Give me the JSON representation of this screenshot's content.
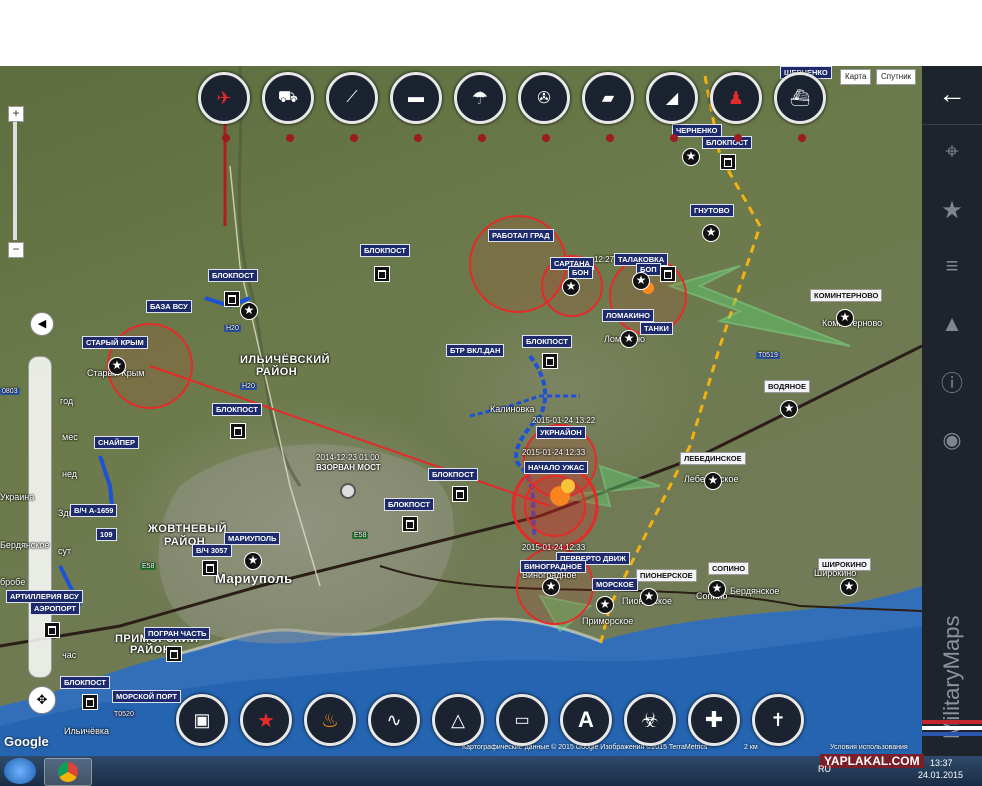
{
  "map_controls": {
    "map_type_map": "Карта",
    "map_type_satellite": "Спутник",
    "zoom_in": "+",
    "zoom_out": "−",
    "google_logo": "Google",
    "attribution": "Картографические данные © 2015 Google Изображения ©2015 TerraMetrics",
    "scale": "2 км",
    "terms": "Условия использования"
  },
  "top_toolbar": {
    "buttons": [
      {
        "name": "aircraft",
        "icon": "jet-icon"
      },
      {
        "name": "armored-car",
        "icon": "armored-car-icon"
      },
      {
        "name": "rocket-launcher",
        "icon": "rocket-launcher-icon"
      },
      {
        "name": "artillery",
        "icon": "artillery-icon"
      },
      {
        "name": "paratroopers",
        "icon": "parachute-icon"
      },
      {
        "name": "helicopter",
        "icon": "helicopter-icon"
      },
      {
        "name": "tank",
        "icon": "tank-icon"
      },
      {
        "name": "self-propelled-gun",
        "icon": "spg-icon"
      },
      {
        "name": "infantry",
        "icon": "soldier-icon"
      },
      {
        "name": "navy",
        "icon": "ship-icon"
      }
    ]
  },
  "bottom_toolbar": {
    "buttons": [
      {
        "name": "checkpoint",
        "icon": "checkpoint-icon"
      },
      {
        "name": "star-position",
        "icon": "star-icon"
      },
      {
        "name": "fire",
        "icon": "fire-icon"
      },
      {
        "name": "route",
        "icon": "route-icon"
      },
      {
        "name": "triangle-zone",
        "icon": "triangle-nodes-icon"
      },
      {
        "name": "ruler",
        "icon": "ruler-icon"
      },
      {
        "name": "text-label",
        "icon": "letter-a-icon",
        "label": "A"
      },
      {
        "name": "biohazard",
        "icon": "biohazard-icon"
      },
      {
        "name": "medical",
        "icon": "medical-cross-icon"
      },
      {
        "name": "grave",
        "icon": "gravestone-icon"
      }
    ]
  },
  "side_panel": {
    "brand": "MilitaryMaps",
    "icons": [
      "back-arrow-icon",
      "location-pin-icon",
      "star-icon",
      "layers-icon",
      "navigation-icon",
      "info-icon",
      "flag-icon"
    ]
  },
  "map_labels": {
    "chernenko": "ЧЕРНЕНКО",
    "blokpost_nw": "БЛОКПОСТ",
    "shevchenko": "ШЕВЧЕНКО",
    "gnutovo": "ГНУТОВО",
    "grad": "РАБОТАЛ ГРАД",
    "sartana": "САРТАНА",
    "bon": "БОН",
    "time_sartana": "12:27",
    "talakovka": "ТАЛАКОВКА",
    "bon2": "БОП",
    "kominternovo_flag": "КОМИНТЕРНОВО",
    "blokpost_center": "БЛОКПОСТ",
    "blokpost_north": "БЛОКПОСТ",
    "baza_vsu": "БАЗА ВСУ",
    "lomakino": "ЛОМАКИНО",
    "tanki": "ТАНКИ",
    "stary_krym": "СТАРЫЙ КРЫМ",
    "btr": "БТР ВКЛ.ДАН",
    "blokpost_lom": "БЛОКПОСТ",
    "vodyanoe": "ВОДЯНОЕ",
    "blokpost_ilich": "БЛОКПОСТ",
    "ukr_fire": "УКРНАЙОН",
    "time_fire1": "2015-01-24 13:22",
    "sniper": "СНАЙПЕР",
    "lebedinskoe": "ЛЕБЕДИНСКОЕ",
    "vzorvan_time": "2014-12-23 01:00",
    "vzorvan": "ВЗОРВАН МОСТ",
    "time_fire2": "2015-01-24 12:33",
    "nachalo": "НАЧАЛО УЖАС",
    "blokpost_e1": "БЛОКПОСТ",
    "blokpost_e2": "БЛОКПОСТ",
    "vch1659": "В/Ч А-1659",
    "vch109": "109",
    "marupol_label": "МАРИУПОЛЬ",
    "vch3057": "В/Ч 3057",
    "time_fire3": "2015-01-24 12:33",
    "pervoe_dvizh": "ПЕРВЕРТО ДВИЖ",
    "vinogradnoe": "ВИНОГРАДНОЕ",
    "pionerskoe": "ПИОНЕРСКОЕ",
    "sopino": "СОПИНО",
    "shirokino": "ШИРОКИНО",
    "morskoe": "МОРСКОЕ",
    "artil_vsu": "АРТИЛЛЕРИЯ ВСУ",
    "aeroport": "АЭРОПОРТ",
    "pogran": "ПОГРАН ЧАСТЬ",
    "morskoy_port": "МОРСКОЙ ПОРТ",
    "blokpost_sw": "БЛОКПОСТ"
  },
  "place_names": {
    "ilichevsky": "ИЛЬИЧЁВСКИЙ",
    "rayon1": "РАЙОН",
    "zhovtnevy": "ЖОВТНЕВЫЙ",
    "rayon2": "РАЙОН",
    "primorsky": "ПРИМОРСКИЙ",
    "rayon3": "РАЙОН",
    "mariupol": "Мариуполь",
    "stary_krym_town": "Старый Крым",
    "kalinovka": "Калиновка",
    "lomakino_town": "Ломакино",
    "kominternovo_town": "Коминтерново",
    "lebedinskoe_town": "Лебединское",
    "shirokino_town": "Широкино",
    "berdyanskoe": "Бердянское",
    "pionerskoe_town": "Пионерское",
    "sopino_town": "Сопино",
    "primorskoe": "Приморское",
    "vinogradnoe_town": "Виноградное",
    "ilichyovka": "Ильичёвка",
    "god": "год",
    "mes": "мес",
    "ned": "нед",
    "zdn": "Здн",
    "sut": "сут",
    "chas": "час",
    "ukrainy": "Украина",
    "berdyanskoe2": "Бердянское",
    "road_h20a": "H20",
    "road_h20b": "H20",
    "road_e58": "E58",
    "road_t0519": "T0519",
    "road_t0520": "T0520",
    "road_0803": "0803",
    "road_e58b": "E58",
    "obrabe": "бробе"
  },
  "taskbar": {
    "lang": "RU",
    "time": "13:37",
    "date": "24.01.2015",
    "watermark": "YAPLAKAL.COM"
  },
  "colors": {
    "ukraine_blue": "#0057b7",
    "ukraine_yellow": "#ffd21c",
    "danger_red": "#e52a2a",
    "sea_blue": "#2e6ec2",
    "panel_bg": "#1e242c",
    "button_bg": "#1b2230"
  }
}
